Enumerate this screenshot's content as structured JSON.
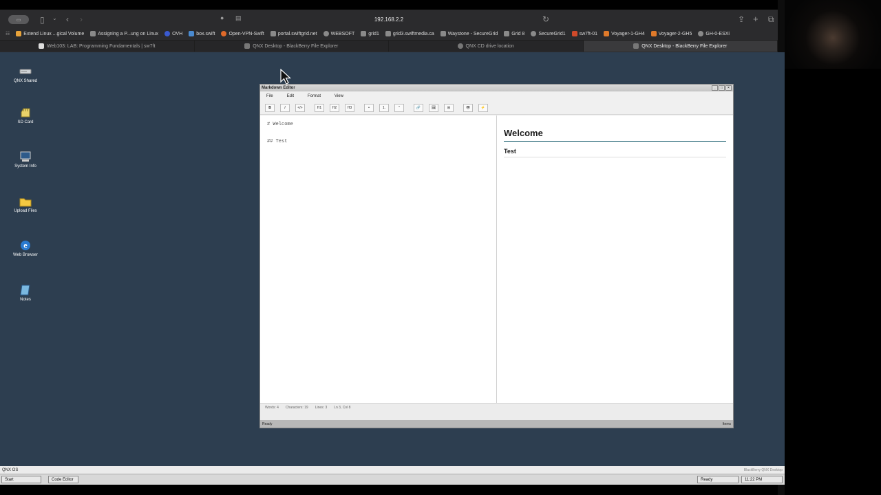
{
  "browser": {
    "url": "192.168.2.2",
    "bookmarks": [
      "Extend Linux ...gical Volume",
      "Assigning a P...ung on Linux",
      "OVH",
      "box.swift",
      "Open-VPN-Swift",
      "portal.swiftgrid.net",
      "WEBSOFT",
      "grid1",
      "grid3.swiftmedia.ca",
      "Waystone - SecureGrid",
      "Grid 8",
      "SecureGrid1",
      "sw7ft-01",
      "Voyager-1-GH4",
      "Voyager-2-GH5",
      "GH-0-ESXi"
    ],
    "tabs": [
      {
        "label": "Web103: LAB: Programming Fundamentals | sw7ft",
        "active": false
      },
      {
        "label": "QNX Desktop - BlackBerry File Explorer",
        "active": false
      },
      {
        "label": "QNX CD drive location",
        "active": false
      },
      {
        "label": "QNX Desktop - BlackBerry File Explorer",
        "active": true
      }
    ]
  },
  "desktop": {
    "icons": [
      {
        "label": "QNX Shared",
        "icon": "drive-icon"
      },
      {
        "label": "SD Card",
        "icon": "sd-card-icon"
      },
      {
        "label": "System Info",
        "icon": "computer-icon"
      },
      {
        "label": "Upload Files",
        "icon": "folder-icon"
      },
      {
        "label": "Web Browser",
        "icon": "web-browser-icon"
      },
      {
        "label": "Notes",
        "icon": "notes-icon"
      }
    ]
  },
  "editor_window": {
    "title": "Markdown Editor",
    "menu": [
      "File",
      "Edit",
      "Format",
      "View"
    ],
    "format_buttons": [
      "B",
      "I",
      "</>",
      "H1",
      "H2",
      "H3",
      "•",
      "1.",
      "\"",
      "🔗",
      "🖼",
      "⊞",
      "👁",
      "⚡"
    ],
    "source_lines": [
      "# Welcome",
      "## Test"
    ],
    "preview_h1": "Welcome",
    "preview_h2": "Test",
    "stats": {
      "words": "Words: 4",
      "chars": "Characters: 19",
      "lines": "Lines: 3",
      "pos": "Ln 3, Col 8"
    },
    "status_left": "Ready",
    "status_right": "Items"
  },
  "taskbar": {
    "os_label": "QNX OS",
    "brand": "BlackBerry QNX Desktop",
    "start": "Start",
    "task": "Code Editor",
    "ready": "Ready",
    "time": "11:22 PM"
  },
  "colors": {
    "desktop": "#2d3e50",
    "accent": "#2c6b7a"
  }
}
